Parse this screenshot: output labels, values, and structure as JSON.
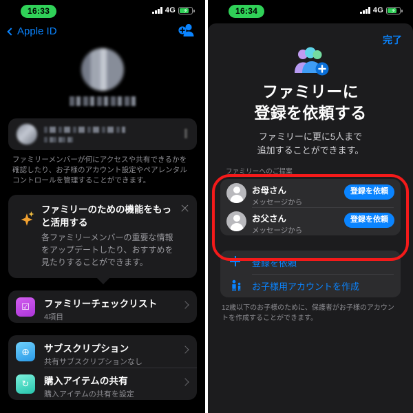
{
  "left": {
    "status": {
      "time": "16:33",
      "network": "4G",
      "signal_icon": "signal-bars-icon",
      "battery_icon": "battery-charging-icon"
    },
    "nav": {
      "back_label": "Apple ID",
      "back_icon": "chevron-left-icon",
      "add_person_icon": "add-person-icon"
    },
    "hero": {
      "avatar_icon": "blurred-avatar",
      "name_redacted": "ファミリー (blurred)"
    },
    "member_row": {
      "redacted_name": "(blurred)",
      "redacted_sub": "(blurred)"
    },
    "footnote": "ファミリーメンバーが何にアクセスや共有できるかを確認したり、お子様のアカウント設定やペアレンタルコントロールを管理することができます。",
    "promo": {
      "icon": "sparkles-icon",
      "title": "ファミリーのための機能をもっと活用する",
      "body": "各ファミリーメンバーの重要な情報をアップデートしたり、おすすめを見たりすることができます。",
      "close_icon": "close-icon"
    },
    "rows": [
      {
        "icon": "checklist-icon",
        "glyph": "✓",
        "color": "#c14ae0",
        "title": "ファミリーチェックリスト",
        "subtitle": "4項目"
      },
      {
        "icon": "subscription-icon",
        "glyph": "✛",
        "color": "#3aa9f0",
        "title": "サブスクリプション",
        "subtitle": "共有サブスクリプションなし"
      },
      {
        "icon": "purchase-sharing-icon",
        "glyph": "↻",
        "color": "#4fe0c8",
        "title": "購入アイテムの共有",
        "subtitle": "購入アイテムの共有を設定"
      }
    ]
  },
  "right": {
    "status": {
      "time": "16:34",
      "network": "4G",
      "signal_icon": "signal-bars-icon",
      "battery_icon": "battery-charging-icon"
    },
    "done_label": "完了",
    "family_icon": "family-add-icon",
    "title_line1": "ファミリーに",
    "title_line2": "登録を依頼する",
    "subtitle_line1": "ファミリーに更に5人まで",
    "subtitle_line2": "追加することができます。",
    "section_label": "ファミリーへのご提案",
    "suggestions": [
      {
        "avatar_icon": "person-placeholder-icon",
        "name": "お母さん",
        "source": "メッセージから",
        "button_label": "登録を依頼"
      },
      {
        "avatar_icon": "person-placeholder-icon",
        "name": "お父さん",
        "source": "メッセージから",
        "button_label": "登録を依頼"
      }
    ],
    "actions": [
      {
        "icon": "plus-icon",
        "label": "登録を依頼"
      },
      {
        "icon": "child-account-icon",
        "label": "お子様用アカウントを作成"
      }
    ],
    "footnote": "12歳以下のお子様のために、保護者がお子様のアカウントを作成することができます。",
    "annotation": {
      "shape": "rounded-rectangle",
      "color": "#f41a1a"
    }
  }
}
